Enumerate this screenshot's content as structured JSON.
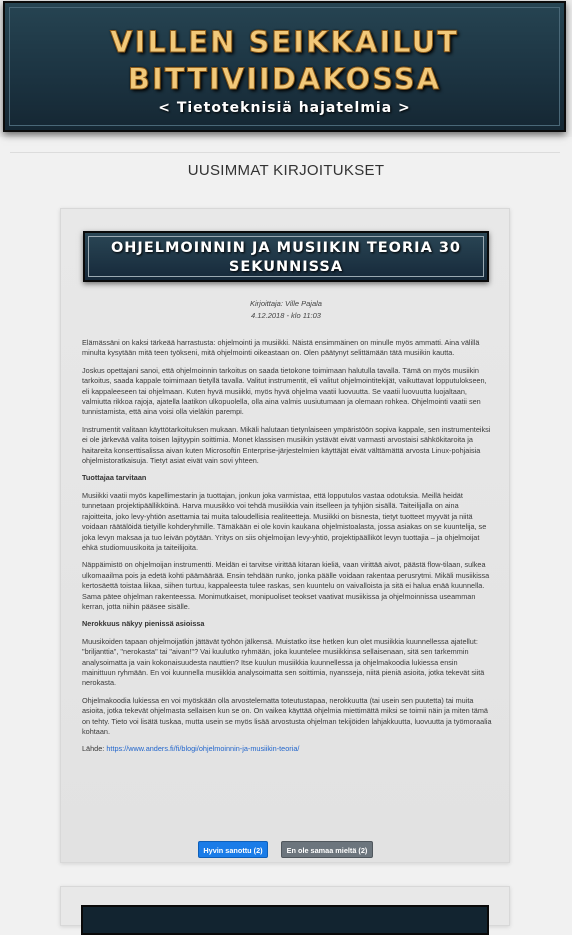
{
  "banner": {
    "title_line1": "VILLEN SEIKKAILUT",
    "title_line2": "BITTIVIIDAKOSSA",
    "subtitle": "< Tietoteknisiä hajatelmia >"
  },
  "section_heading": "UUSIMMAT KIRJOITUKSET",
  "post": {
    "title": "OHJELMOINNIN JA MUSIIKIN TEORIA 30 SEKUNNISSA",
    "author": "Kirjoittaja: Ville Pajala",
    "date": "4.12.2018 - klo 11:03",
    "paragraphs": [
      "Elämässäni on kaksi tärkeää harrastusta: ohjelmointi ja musiikki. Näistä ensimmäinen on minulle myös ammatti. Aina välillä minulta kysytään mitä teen työkseni, mitä ohjelmointi oikeastaan on. Olen päätynyt selittämään tätä musiikin kautta.",
      "Joskus opettajani sanoi, että ohjelmoinnin tarkoitus on saada tietokone toimimaan halutulla tavalla. Tämä on myös musiikin tarkoitus, saada kappale toimimaan tietyllä tavalla. Valitut instrumentit, eli valitut ohjelmointitekijät, vaikuttavat lopputulokseen, eli kappaleeseen tai ohjelmaan. Kuten hyvä musiikki, myös hyvä ohjelma vaatii luovuutta. Se vaatii luovuutta luojaltaan, valmiutta rikkoa rajoja, ajatella laatikon ulkopuolella, olla aina valmis uusiutumaan ja olemaan rohkea. Ohjelmointi vaatii sen tunnistamista, että aina voisi olla vieläkin parempi.",
      "Instrumentit valitaan käyttötarkoituksen mukaan. Mikäli halutaan tietynlaiseen ympäristöön sopiva kappale, sen instrumenteiksi ei ole järkevää valita toisen lajityypin soittimia. Monet klassisen musiikin ystävät eivät varmasti arvostaisi sähkökitaroita ja haitareita konserttisalissa aivan kuten Microsoftin Enterprise-järjestelmien käyttäjät eivät välttämättä arvosta Linux-pohjaisia ohjelmistoratkaisuja. Tietyt asiat eivät vain sovi yhteen."
    ],
    "heading1": "Tuottajaa tarvitaan",
    "paragraphs2": [
      "Musiikki vaatii myös kapellimestarin ja tuottajan, jonkun joka varmistaa, että lopputulos vastaa odotuksia. Meillä heidät tunnetaan projektipäällikköinä. Harva muusikko voi tehdä musiikkia vain itselleen ja tyhjiön sisällä. Taiteilijalla on aina rajoitteita, joko levy-yhtiön asettamia tai muita taloudellisia realiteetteja. Musiikki on bisnesta, tietyt tuotteet myyvät ja niitä voidaan räätälöidä tietyille kohderyhmille. Tämäkään ei ole kovin kaukana ohjelmistoalasta, jossa asiakas on se kuuntelija, se joka levyn maksaa ja tuo leivän pöytään. Yritys on siis ohjelmoijan levy-yhtiö, projektipäälliköt levyn tuottajia – ja ohjelmoijat ehkä studiomuusikoita ja taiteilijoita.",
      "Näppäimistö on ohjelmoijan instrumentti. Meidän ei tarvitse virittää kitaran kieliä, vaan virittää aivot, päästä flow-tilaan, sulkea ulkomaailma pois ja edetä kohti päämäärää. Ensin tehdään runko, jonka päälle voidaan rakentaa perusrytmi. Mikäli musiikissa kertosäettä toistaa liikaa, siihen turtuu, kappaleesta tulee raskas, sen kuuntelu on vaivalloista ja sitä ei halua enää kuunnella. Sama pätee ohjelman rakenteessa. Monimutkaiset, monipuoliset teokset vaativat musiikissa ja ohjelmoinnissa useamman kerran, jotta niihin pääsee sisälle."
    ],
    "heading2": "Nerokkuus näkyy pienissä asioissa",
    "paragraphs3": [
      "Muusikoiden tapaan ohjelmoijatkin jättävät työhön jälkensä. Muistatko itse hetken kun olet musiikkia kuunnellessa ajatellut: \"briljanttia\", \"nerokasta\" tai \"aivan!\"? Vai kuulutko ryhmään, joka kuuntelee musiikkinsa sellaisenaan, sitä sen tarkemmin analysoimatta ja vain kokonaisuudesta nauttien? Itse kuulun musiikkia kuunnellessa ja ohjelmakoodia lukiessa ensin mainittuun ryhmään. En voi kuunnella musiikkia analysoimatta sen soittimia, nyansseja, niitä pieniä asioita, jotka tekevät siitä nerokasta.",
      "Ohjelmakoodia lukiessa en voi myöskään olla arvostelematta toteutustapaa, nerokkuutta (tai usein sen puutetta) tai muita asioita, jotka tekevät ohjelmasta sellaisen kun se on. On vaikea käyttää ohjelmia miettimättä miksi se toimii näin ja miten tämä on tehty. Tieto voi lisätä tuskaa, mutta usein se myös lisää arvostusta ohjelman tekijöiden lahjakkuutta, luovuutta ja työmoraalia kohtaan."
    ],
    "source_label": "Lähde: ",
    "source_link": "https://www.anders.fi/fi/blogi/ohjelmoinnin-ja-musiikin-teoria/",
    "like_button": "Hyvin sanottu (2)",
    "dislike_button": "En ole samaa mieltä (2)"
  }
}
